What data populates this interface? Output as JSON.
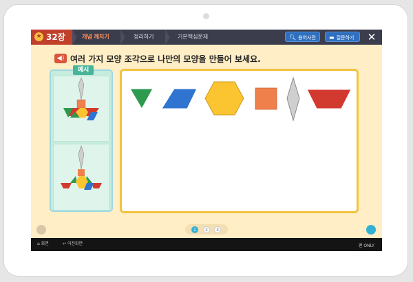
{
  "header": {
    "chapter_label": "32장",
    "tabs": [
      {
        "label": "개념 깨치기",
        "active": true
      },
      {
        "label": "정리하기",
        "active": false
      },
      {
        "label": "기본핵심문제",
        "active": false
      }
    ],
    "dictionary_button": "용어사전",
    "question_button": "질문하기",
    "close_label": "✕"
  },
  "instruction": {
    "text": "여러 가지 모양 조각으로 나만의 모양을 만들어 보세요."
  },
  "example_panel": {
    "tag": "예시"
  },
  "shapes": [
    {
      "name": "triangle",
      "color": "#2e9a4e"
    },
    {
      "name": "parallelogram",
      "color": "#2f74d0"
    },
    {
      "name": "hexagon",
      "color": "#fbc531"
    },
    {
      "name": "square",
      "color": "#f0804b"
    },
    {
      "name": "rhombus",
      "color": "#cfcfcf"
    },
    {
      "name": "trapezoid",
      "color": "#d23a2f"
    }
  ],
  "pagination": {
    "pages": [
      "1",
      "2",
      "3"
    ],
    "current": "1"
  },
  "bottom_bar": {
    "home_label": "화면",
    "back_label": "이전화면",
    "pen_label": "펜 ONLY"
  },
  "colors": {
    "background": "#ffeec6",
    "top_bar": "#3b3d4d",
    "chapter_red": "#c0402b",
    "active_tab": "#ff8f5a",
    "work_border": "#f3c23e",
    "example_bg": "#c6ecdd"
  }
}
